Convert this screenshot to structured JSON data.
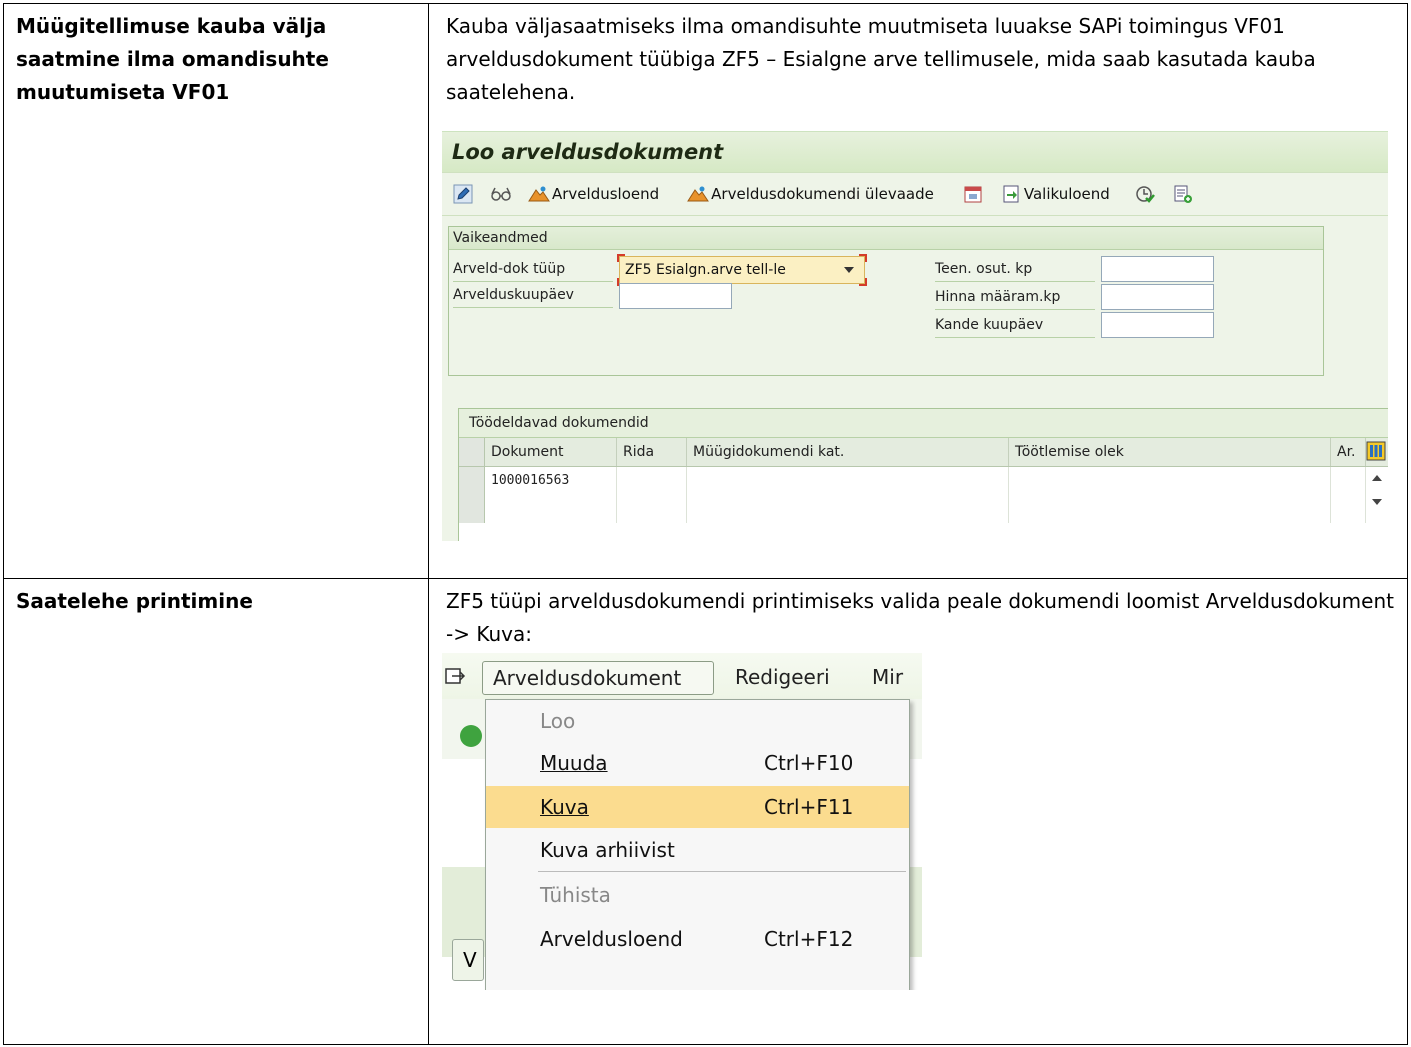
{
  "row1": {
    "label": "Müügitellimuse kauba välja saatmine ilma omandisuhte muutumiseta VF01",
    "description": "Kauba väljasaatmiseks ilma omandisuhte muutmiseta luuakse SAPi toimingus VF01 arveldusdokument tüübiga ZF5 – Esialgne arve tellimusele, mida saab kasutada kauba saatelehena.",
    "screen": {
      "title": "Loo arveldusdokument",
      "toolbar": {
        "billing_list": "Arveldusloend",
        "billing_overview": "Arveldusdokumendi ülevaade",
        "selection_list": "Valikuloend"
      },
      "group_title": "Vaikeandmed",
      "billing_type_label": "Arveld-dok tüüp",
      "billing_type_value": "ZF5 Esialgn.arve tell-le",
      "billing_date_label": "Arvelduskuupäev",
      "service_date_label": "Teen. osut. kp",
      "pricing_date_label": "Hinna määram.kp",
      "posting_date_label": "Kande kuupäev",
      "grid": {
        "title": "Töödeldavad dokumendid",
        "columns": [
          "Dokument",
          "Rida",
          "Müügidokumendi kat.",
          "Töötlemise olek",
          "Ar."
        ],
        "rows": [
          [
            "1000016563",
            "",
            "",
            "",
            ""
          ]
        ]
      }
    }
  },
  "row2": {
    "label": "Saatelehe printimine",
    "description": "ZF5 tüüpi arveldusdokumendi printimiseks valida peale dokumendi loomist Arveldusdokument -> Kuva:",
    "menu": {
      "bar": [
        "Arveldusdokument",
        "Redigeeri",
        "Mir"
      ],
      "items": [
        {
          "label": "Loo",
          "shortcut": "",
          "disabled": true
        },
        {
          "label": "Muuda",
          "shortcut": "Ctrl+F10",
          "disabled": false
        },
        {
          "label": "Kuva",
          "shortcut": "Ctrl+F11",
          "disabled": false,
          "highlighted": true
        },
        {
          "label": "Kuva arhiivist",
          "shortcut": "",
          "disabled": false
        },
        {
          "label": "Tühista",
          "shortcut": "",
          "disabled": true
        },
        {
          "label": "Arveldusloend",
          "shortcut": "Ctrl+F12",
          "disabled": false
        }
      ]
    }
  },
  "colors": {
    "sap_green_header": "#d6e9c5",
    "menu_highlight": "#fbdc8f"
  }
}
